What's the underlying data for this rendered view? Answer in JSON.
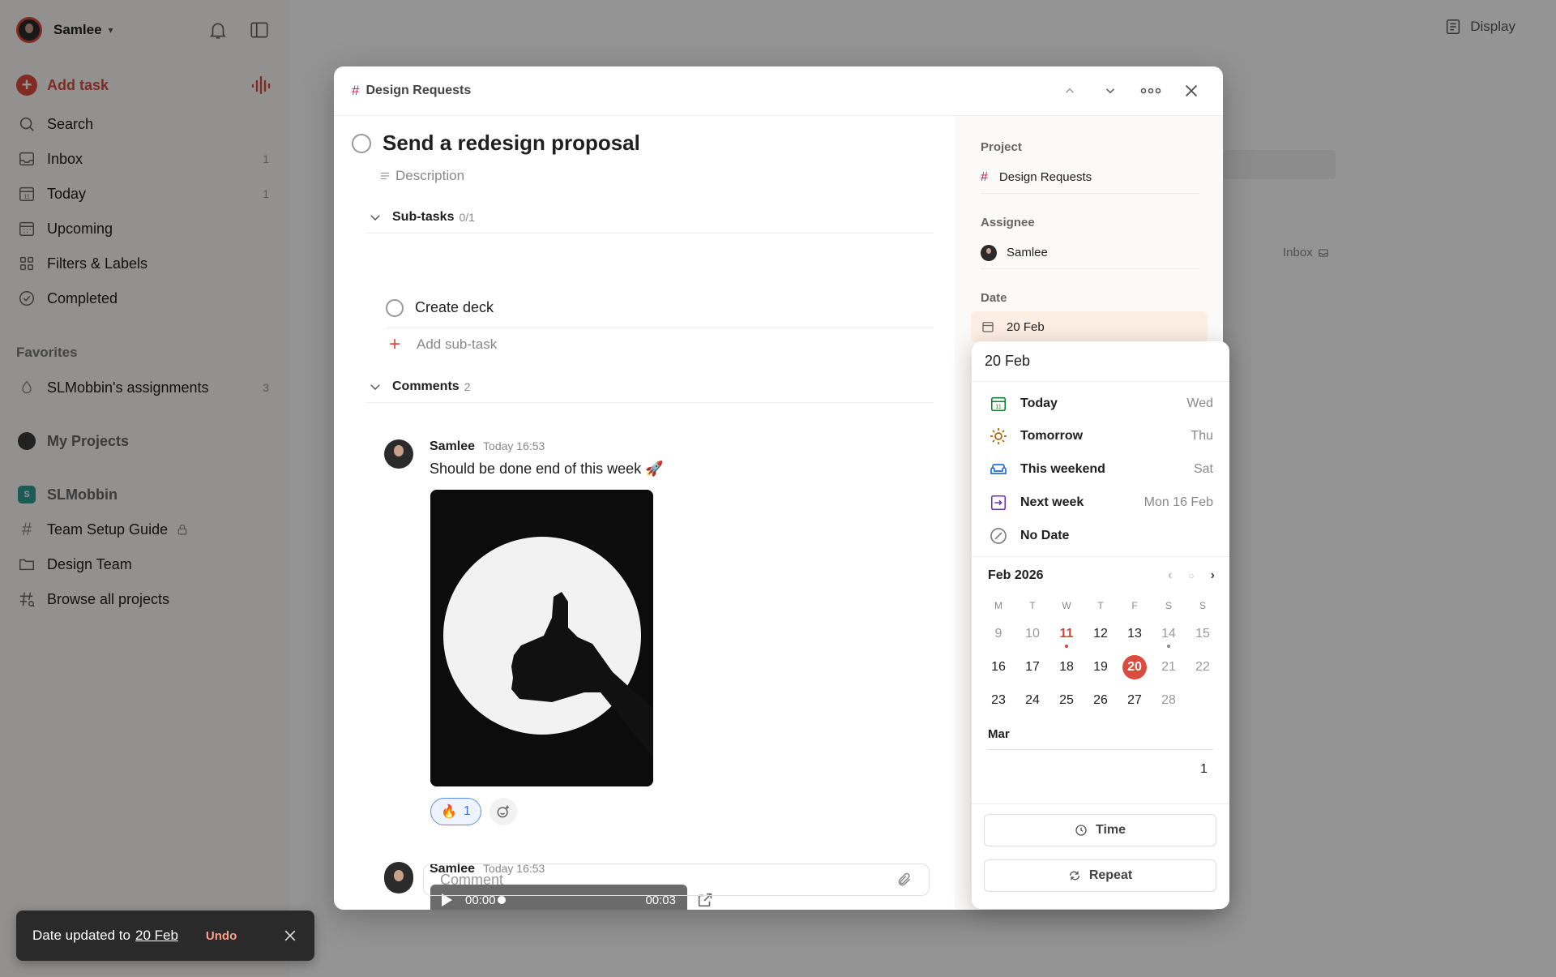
{
  "sidebar": {
    "user": "Samlee",
    "add_task": "Add task",
    "nav": [
      {
        "label": "Search",
        "count": ""
      },
      {
        "label": "Inbox",
        "count": "1"
      },
      {
        "label": "Today",
        "count": "1"
      },
      {
        "label": "Upcoming",
        "count": ""
      },
      {
        "label": "Filters & Labels",
        "count": ""
      },
      {
        "label": "Completed",
        "count": ""
      }
    ],
    "favorites_label": "Favorites",
    "favorites": [
      {
        "label": "SLMobbin's assignments",
        "count": "3"
      }
    ],
    "my_projects": "My Projects",
    "workspace": "SLMobbin",
    "projects": [
      "Team Setup Guide",
      "Design Team",
      "Browse all projects"
    ]
  },
  "main": {
    "display": "Display",
    "inbox_tag": "Inbox"
  },
  "modal": {
    "breadcrumb": "Design Requests",
    "title": "Send a redesign proposal",
    "description_placeholder": "Description",
    "subtasks_label": "Sub-tasks",
    "subtasks_count": "0/1",
    "subtask": "Create deck",
    "add_subtask": "Add sub-task",
    "comments_label": "Comments",
    "comments_count": "2",
    "comments": [
      {
        "author": "Samlee",
        "time": "Today 16:53",
        "text": "Should be done end of this week 🚀",
        "reaction_emoji": "🔥",
        "reaction_count": "1"
      },
      {
        "author": "Samlee",
        "time": "Today 16:53",
        "audio_start": "00:00",
        "audio_end": "00:03"
      }
    ],
    "comment_placeholder": "Comment"
  },
  "details": {
    "project_label": "Project",
    "project": "Design Requests",
    "assignee_label": "Assignee",
    "assignee": "Samlee",
    "date_label": "Date",
    "date": "20 Feb"
  },
  "picker": {
    "input": "20 Feb",
    "quick": [
      {
        "label": "Today",
        "day": "Wed",
        "icon": "calendar-today-icon",
        "color": "#058527"
      },
      {
        "label": "Tomorrow",
        "day": "Thu",
        "icon": "sun-icon",
        "color": "#ad6200"
      },
      {
        "label": "This weekend",
        "day": "Sat",
        "icon": "sofa-icon",
        "color": "#246fe0"
      },
      {
        "label": "Next week",
        "day": "Mon 16 Feb",
        "icon": "next-week-icon",
        "color": "#692fc2"
      },
      {
        "label": "No Date",
        "day": "",
        "icon": "no-date-icon",
        "color": "#808080"
      }
    ],
    "month": "Feb 2026",
    "weekdays": [
      "M",
      "T",
      "W",
      "T",
      "F",
      "S",
      "S"
    ],
    "weeks": [
      [
        "9",
        "10",
        "11",
        "12",
        "13",
        "14",
        "15"
      ],
      [
        "16",
        "17",
        "18",
        "19",
        "20",
        "21",
        "22"
      ],
      [
        "23",
        "24",
        "25",
        "26",
        "27",
        "28",
        ""
      ]
    ],
    "next_month": "Mar",
    "next_month_first": "1",
    "time_button": "Time",
    "repeat_button": "Repeat"
  },
  "toast": {
    "text": "Date updated to",
    "link": "20 Feb",
    "undo": "Undo"
  },
  "colors": {
    "accent": "#dc4c3e",
    "project_hash": "#b8255f",
    "workspace": "#2f9e8f"
  }
}
